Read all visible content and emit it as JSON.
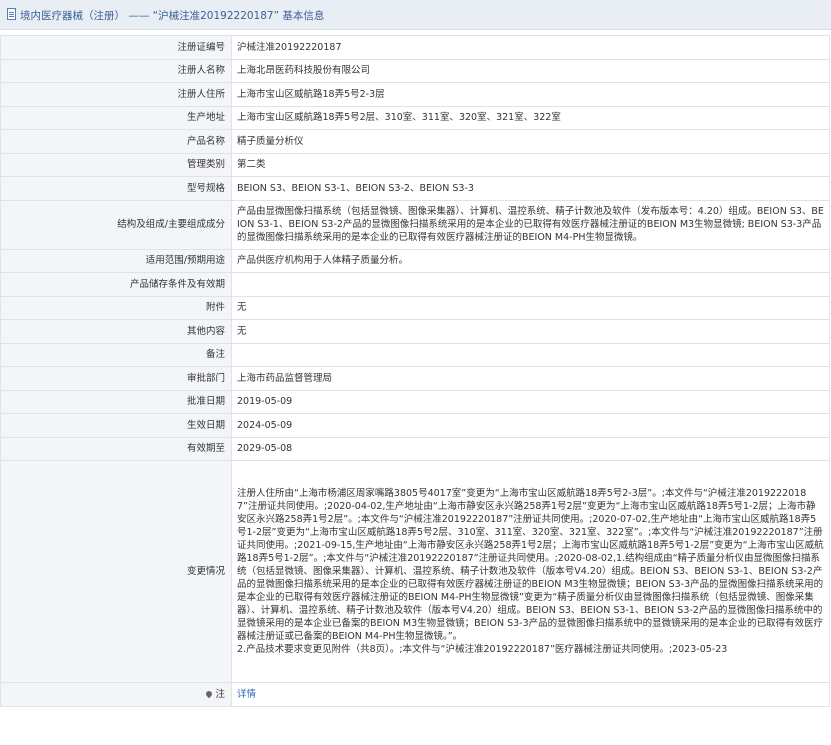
{
  "header": {
    "title": "境内医疗器械（注册） —— “沪械注准20192220187” 基本信息"
  },
  "rows": [
    {
      "label": "注册证编号",
      "value": "沪械注准20192220187"
    },
    {
      "label": "注册人名称",
      "value": "上海北昂医药科技股份有限公司"
    },
    {
      "label": "注册人住所",
      "value": "上海市宝山区威航路18弄5号2-3层"
    },
    {
      "label": "生产地址",
      "value": "上海市宝山区威航路18弄5号2层、310室、311室、320室、321室、322室"
    },
    {
      "label": "产品名称",
      "value": "精子质量分析仪"
    },
    {
      "label": "管理类别",
      "value": "第二类"
    },
    {
      "label": "型号规格",
      "value": "BEION S3、BEION S3-1、BEION S3-2、BEION S3-3"
    },
    {
      "label": "结构及组成/主要组成成分",
      "value": "产品由显微图像扫描系统（包括显微镜、图像采集器）、计算机、温控系统、精子计数池及软件（发布版本号：4.20）组成。BEION S3、BEION S3-1、BEION S3-2产品的显微图像扫描系统采用的是本企业的已取得有效医疗器械注册证的BEION M3生物显微镜; BEION S3-3产品的显微图像扫描系统采用的是本企业的已取得有效医疗器械注册证的BEION M4-PH生物显微镜。"
    },
    {
      "label": "适用范围/预期用途",
      "value": "产品供医疗机构用于人体精子质量分析。"
    },
    {
      "label": "产品储存条件及有效期",
      "value": ""
    },
    {
      "label": "附件",
      "value": "无"
    },
    {
      "label": "其他内容",
      "value": "无"
    },
    {
      "label": "备注",
      "value": ""
    },
    {
      "label": "审批部门",
      "value": "上海市药品监督管理局"
    },
    {
      "label": "批准日期",
      "value": "2019-05-09"
    },
    {
      "label": "生效日期",
      "value": "2024-05-09"
    },
    {
      "label": "有效期至",
      "value": "2029-05-08"
    },
    {
      "label": "变更情况",
      "value": "注册人住所由“上海市杨浦区周家嘴路3805号4017室”变更为“上海市宝山区威航路18弄5号2-3层”。;本文件与“沪械注准20192220187”注册证共同使用。;2020-04-02,生产地址由“上海市静安区永兴路258弄1号2层”变更为“上海市宝山区威航路18弄5号1-2层；上海市静安区永兴路258弄1号2层”。;本文件与“沪械注准20192220187”注册证共同使用。;2020-07-02,生产地址由“上海市宝山区威航路18弄5号1-2层”变更为“上海市宝山区威航路18弄5号2层、310室、311室、320室、321室、322室”。;本文件与“沪械注准20192220187”注册证共同使用。;2021-09-15,生产地址由“上海市静安区永兴路258弄1号2层；上海市宝山区威航路18弄5号1-2层”变更为“上海市宝山区威航路18弄5号1-2层”。;本文件与“沪械注准20192220187”注册证共同使用。;2020-08-02,1.结构组成由“精子质量分析仪由显微图像扫描系统（包括显微镜、图像采集器）、计算机、温控系统、精子计数池及软件（版本号V4.20）组成。BEION S3、BEION S3-1、BEION S3-2产品的显微图像扫描系统采用的是本企业的已取得有效医疗器械注册证的BEION M3生物显微镜；BEION S3-3产品的显微图像扫描系统采用的是本企业的已取得有效医疗器械注册证的BEION M4-PH生物显微镜”变更为“精子质量分析仪由显微图像扫描系统（包括显微镜、图像采集器）、计算机、温控系统、精子计数池及软件（版本号V4.20）组成。BEION S3、BEION S3-1、BEION S3-2产品的显微图像扫描系统中的显微镜采用的是本企业已备案的BEION M3生物显微镜；BEION S3-3产品的显微图像扫描系统中的显微镜采用的是本企业的已取得有效医疗器械注册证或已备案的BEION M4-PH生物显微镜。”。",
      "extra": "2.产品技术要求变更见附件（共8页）。;本文件与“沪械注准20192220187”医疗器械注册证共同使用。;2023-05-23"
    }
  ],
  "footer": {
    "icon": "location-pin-icon",
    "label": "注",
    "link_text": "详情"
  }
}
